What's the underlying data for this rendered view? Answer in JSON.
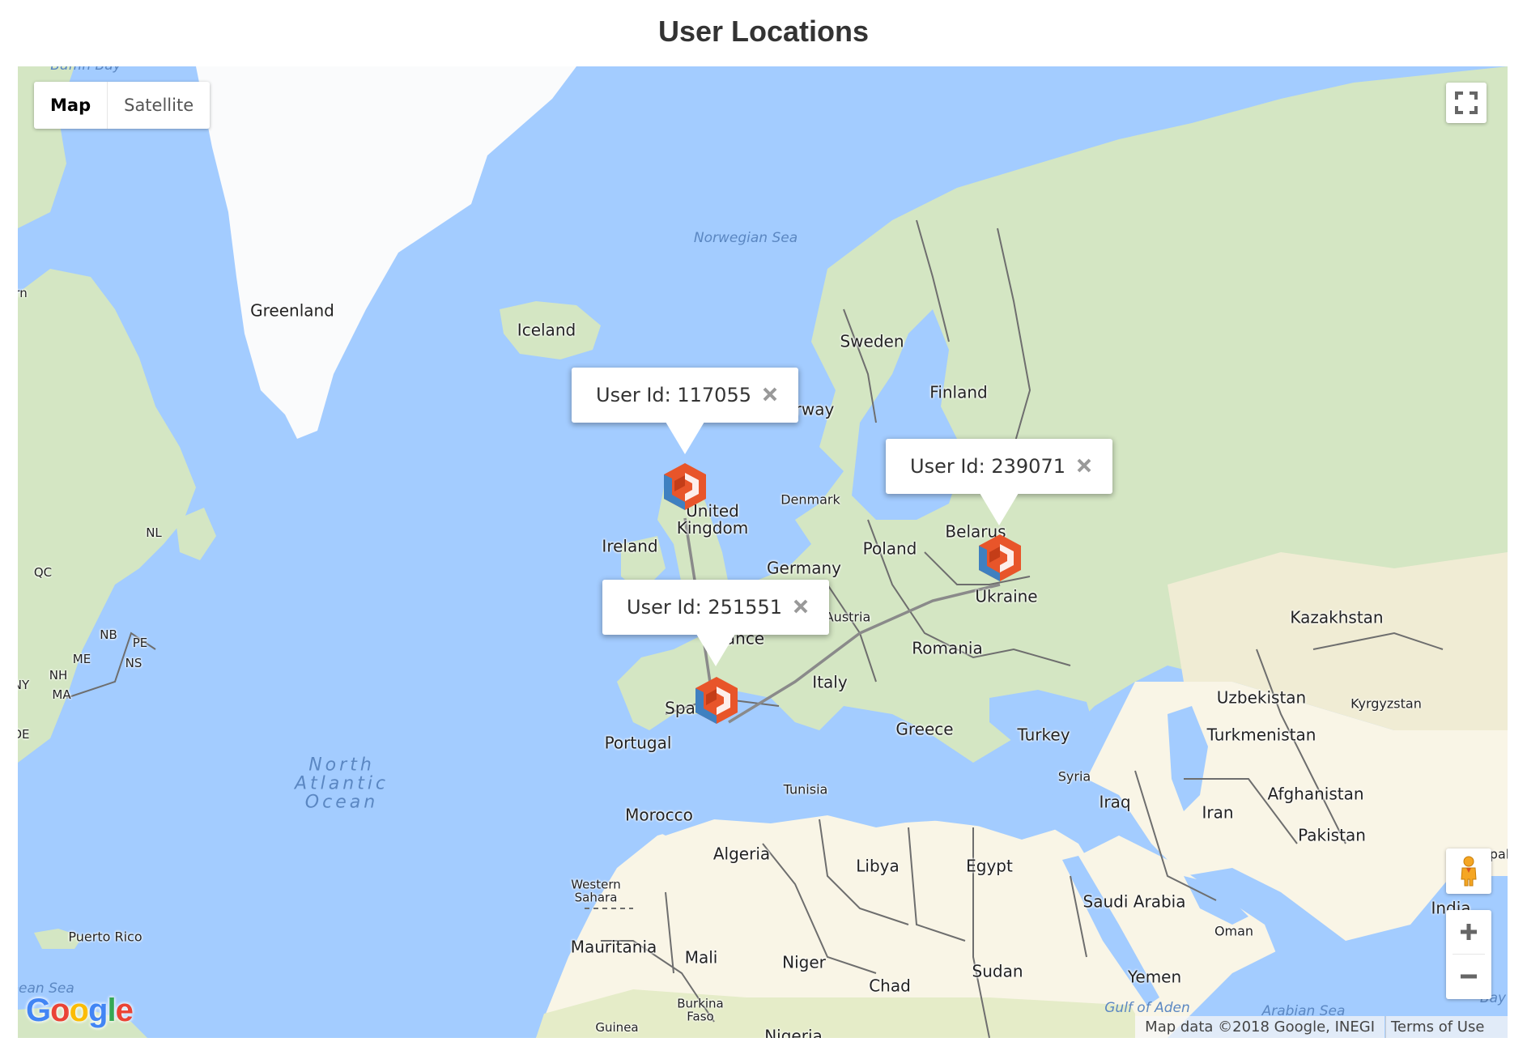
{
  "page": {
    "title": "User Locations"
  },
  "map": {
    "map_type_options": [
      {
        "label": "Map",
        "selected": true
      },
      {
        "label": "Satellite",
        "selected": false
      }
    ],
    "colors": {
      "water": "#a3ccff",
      "land": "#d4e6c3",
      "desert": "#f9f5e6",
      "ice": "#fafbfc",
      "border": "#6e6e6e",
      "polyline": "#8a8a8a",
      "marker_orange": "#e8552a",
      "marker_blue": "#3f80c0"
    },
    "attribution": "Map data ©2018 Google, INEGI",
    "terms_label": "Terms of Use",
    "logo_text": "Google",
    "controls": {
      "fullscreen_icon": "fullscreen-icon",
      "pegman_icon": "pegman-icon",
      "zoom_in_icon": "plus-icon",
      "zoom_out_icon": "minus-icon"
    },
    "info_windows": [
      {
        "text": "User Id: 117055",
        "close_icon": "close-icon"
      },
      {
        "text": "User Id: 239071",
        "close_icon": "close-icon"
      },
      {
        "text": "User Id: 251551",
        "close_icon": "close-icon"
      }
    ],
    "markers": [
      {
        "user_id": "117055",
        "location": "United Kingdom",
        "icon": "hexagon-cube-marker-icon"
      },
      {
        "user_id": "239071",
        "location": "Ukraine",
        "icon": "hexagon-cube-marker-icon"
      },
      {
        "user_id": "251551",
        "location": "Spain",
        "icon": "hexagon-cube-marker-icon"
      }
    ],
    "labels": {
      "greenland": "Greenland",
      "iceland": "Iceland",
      "norwegian_sea": "Norwegian Sea",
      "baffin_bay": "Baffin Bay",
      "north_atlantic": "North\nAtlantic\nOcean",
      "caribbean": "bean Sea",
      "puerto_rico": "Puerto Rico",
      "sweden": "Sweden",
      "finland": "Finland",
      "norway": "rway",
      "denmark": "Denmark",
      "united_kingdom": "United\nKingdom",
      "ireland": "Ireland",
      "belarus": "Belarus",
      "poland": "Poland",
      "germany": "Germany",
      "austria": "Austria",
      "france": "ance",
      "ukraine": "Ukraine",
      "romania": "Romania",
      "kazakhstan": "Kazakhstan",
      "uzbekistan": "Uzbekistan",
      "kyrgyzstan": "Kyrgyzstan",
      "turkmenistan": "Turkmenistan",
      "italy": "Italy",
      "greece": "Greece",
      "turkey": "Turkey",
      "spain": "Spa",
      "portugal": "Portugal",
      "syria": "Syria",
      "iraq": "Iraq",
      "iran": "Iran",
      "afghanistan": "Afghanistan",
      "pakistan": "Pakistan",
      "india": "India",
      "nepal": "pal",
      "tunisia": "Tunisia",
      "morocco": "Morocco",
      "algeria": "Algeria",
      "libya": "Libya",
      "egypt": "Egypt",
      "western_sahara": "Western\nSahara",
      "saudi_arabia": "Saudi Arabia",
      "oman": "Oman",
      "mauritania": "Mauritania",
      "mali": "Mali",
      "niger": "Niger",
      "chad": "Chad",
      "sudan": "Sudan",
      "yemen": "Yemen",
      "burkina_faso": "Burkina\nFaso",
      "guinea": "Guinea",
      "nigeria": "Nigeria",
      "gulf_of_aden": "Gulf of Aden",
      "arabian_sea": "Arabian Sea",
      "bay_of_bengal": "Bay",
      "nl": "NL",
      "qc": "QC",
      "nb": "NB",
      "pe": "PE",
      "ns": "NS",
      "me": "ME",
      "nh": "NH",
      "ny": "NY",
      "ma": "MA",
      "de": "DE",
      "on": "rn"
    }
  }
}
